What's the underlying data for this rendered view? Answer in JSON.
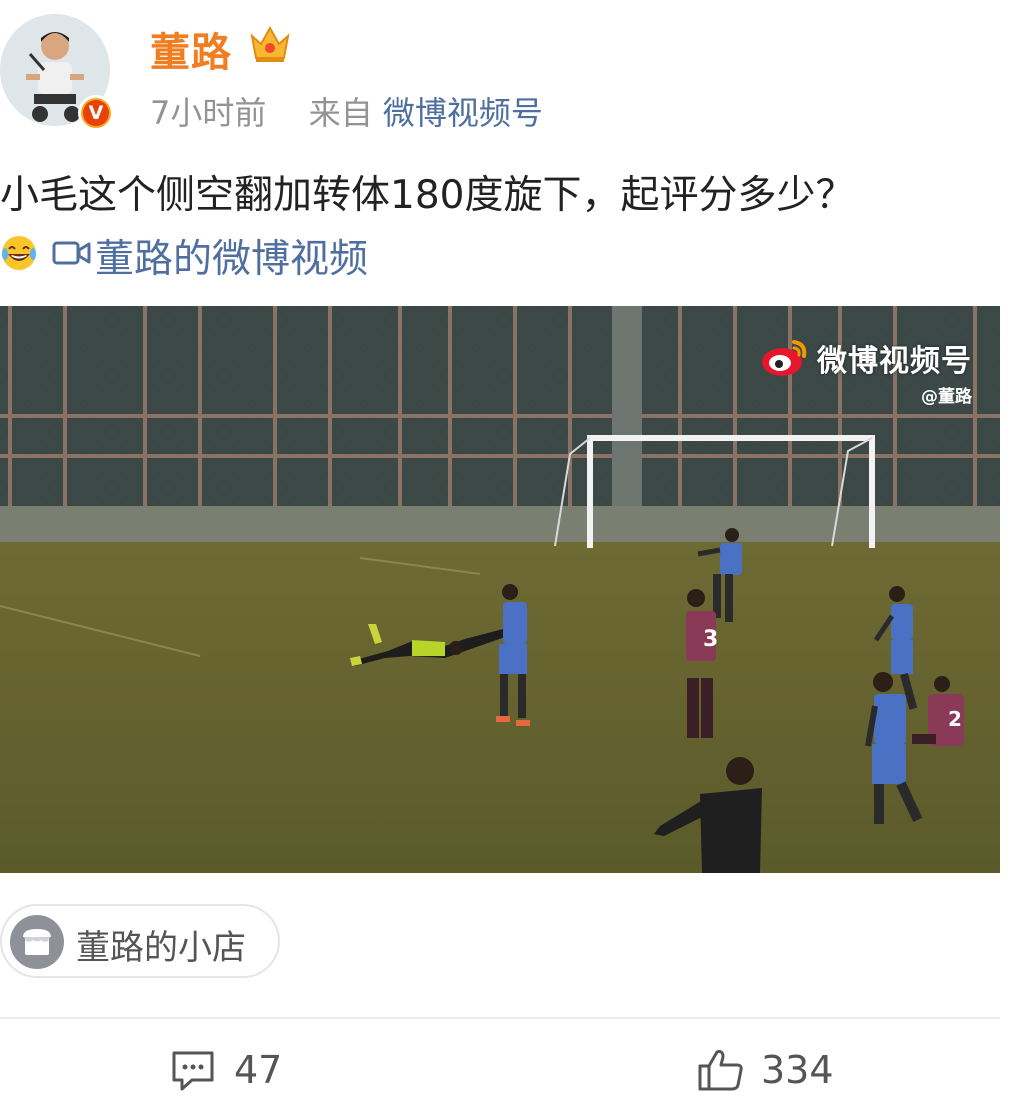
{
  "user": {
    "name": "董路",
    "badge": "V"
  },
  "meta": {
    "time": "7小时前",
    "from_label": "来自",
    "source": "微博视频号"
  },
  "post": {
    "text": "小毛这个侧空翻加转体180度旋下，起评分多少？",
    "video_link": "董路的微博视频"
  },
  "video": {
    "watermark_title": "微博视频号",
    "watermark_sub": "@董路",
    "jersey_1": "3",
    "jersey_2": "2"
  },
  "shop": {
    "label": "董路的小店"
  },
  "actions": {
    "comments": "47",
    "likes": "334"
  },
  "colors": {
    "username": "#f07d22",
    "link": "#4e6f9f",
    "meta": "#939393"
  }
}
